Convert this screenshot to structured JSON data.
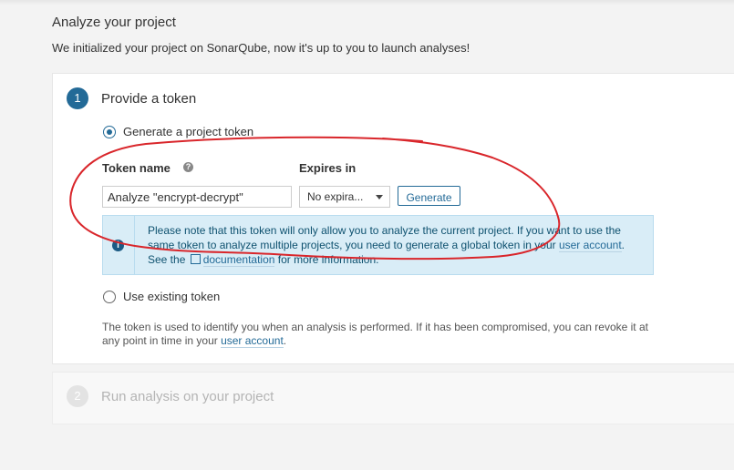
{
  "header": {
    "title": "Analyze your project",
    "description": "We initialized your project on SonarQube, now it's up to you to launch analyses!"
  },
  "step1": {
    "number": "1",
    "title": "Provide a token",
    "generate_option": "Generate a project token",
    "token_name_label": "Token name",
    "token_name_value": "Analyze \"encrypt-decrypt\"",
    "expires_label": "Expires in",
    "expires_value": "No expira...",
    "generate_button": "Generate",
    "info": {
      "text_before": "Please note that this token will only allow you to analyze the current project. If you want to use the same token to analyze multiple projects, you need to generate a global token in your ",
      "link_user_account": "user account",
      "text_middle": ". See the ",
      "link_documentation": "documentation",
      "text_after": " for more information."
    },
    "existing_option": "Use existing token",
    "note_before": "The token is used to identify you when an analysis is performed. If it has been compromised, you can revoke it at any point in time in your ",
    "note_link": "user account",
    "note_after": "."
  },
  "step2": {
    "number": "2",
    "title": "Run analysis on your project"
  },
  "colors": {
    "accent": "#236a97",
    "info_bg": "#d9edf7",
    "annotation": "#d9262b"
  },
  "icons": {
    "help": "question-circle-icon",
    "info": "info-circle-icon",
    "external": "external-link-icon"
  }
}
